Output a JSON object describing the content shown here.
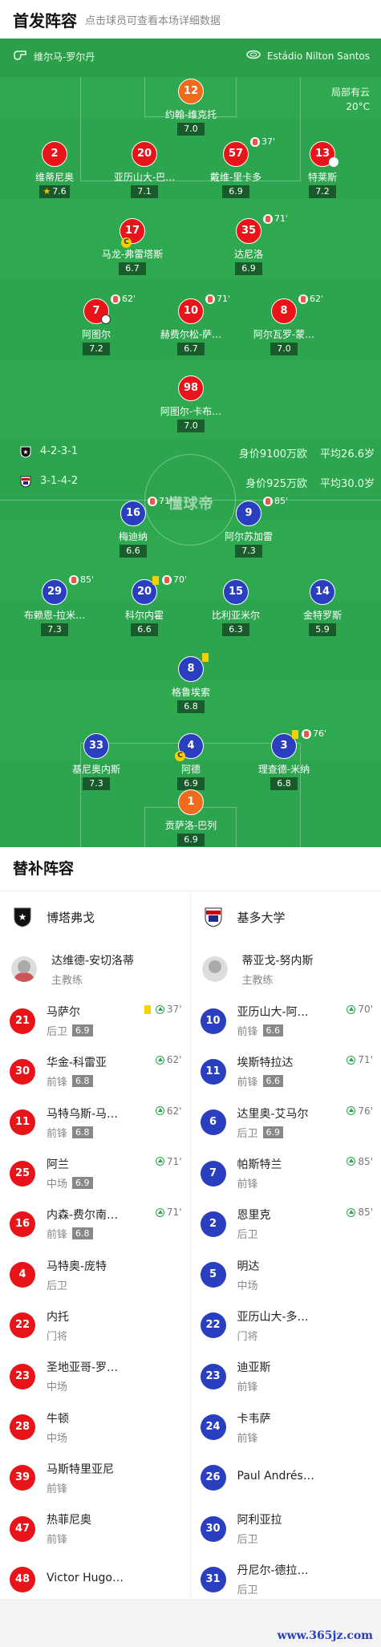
{
  "header": {
    "title": "首发阵容",
    "subtitle": "点击球员可查看本场详细数据"
  },
  "pitch": {
    "referee": "维尔马-罗尔丹",
    "stadium": "Estádio Nilton Santos",
    "weather": "局部有云",
    "temperature": "20°C",
    "center_logo": "懂球帝",
    "home_info": {
      "formation": "4-2-3-1",
      "value": "身价9100万欧",
      "age": "平均26.6岁"
    },
    "away_info": {
      "formation": "3-1-4-2",
      "value": "身价925万欧",
      "age": "平均30.0岁"
    },
    "home_players": [
      {
        "num": "12",
        "name": "约翰-维克托",
        "rating": "7.0",
        "color": "orange"
      },
      {
        "num": "2",
        "name": "维蒂尼奥",
        "rating": "7.6",
        "color": "red",
        "star": true
      },
      {
        "num": "20",
        "name": "亚历山大-巴…",
        "rating": "7.1",
        "color": "red"
      },
      {
        "num": "57",
        "name": "戴维-里卡多",
        "rating": "6.9",
        "color": "red",
        "sub": "37'"
      },
      {
        "num": "13",
        "name": "特莱斯",
        "rating": "7.2",
        "color": "red"
      },
      {
        "num": "17",
        "name": "马龙-弗雷塔斯",
        "rating": "6.7",
        "color": "red",
        "captain": "C"
      },
      {
        "num": "35",
        "name": "达尼洛",
        "rating": "6.9",
        "color": "red",
        "sub": "71'"
      },
      {
        "num": "7",
        "name": "阿图尔",
        "rating": "7.2",
        "color": "red",
        "sub": "62'"
      },
      {
        "num": "10",
        "name": "赫费尔松-萨…",
        "rating": "6.7",
        "color": "red",
        "sub": "71'"
      },
      {
        "num": "8",
        "name": "阿尔瓦罗-蒙…",
        "rating": "7.0",
        "color": "red",
        "sub": "62'"
      },
      {
        "num": "98",
        "name": "阿图尔-卡布…",
        "rating": "7.0",
        "color": "red"
      }
    ],
    "away_players": [
      {
        "num": "16",
        "name": "梅迪纳",
        "rating": "6.6",
        "color": "blue",
        "sub": "71'"
      },
      {
        "num": "9",
        "name": "阿尔苏加雷",
        "rating": "7.3",
        "color": "blue",
        "sub": "85'"
      },
      {
        "num": "29",
        "name": "布赖恩-拉米…",
        "rating": "7.3",
        "color": "blue",
        "sub": "85'"
      },
      {
        "num": "20",
        "name": "科尔内霍",
        "rating": "6.6",
        "color": "blue",
        "sub": "70'",
        "yellow": true
      },
      {
        "num": "15",
        "name": "比利亚米尔",
        "rating": "6.3",
        "color": "blue"
      },
      {
        "num": "14",
        "name": "金特罗斯",
        "rating": "5.9",
        "color": "blue"
      },
      {
        "num": "8",
        "name": "格鲁埃索",
        "rating": "6.8",
        "color": "blue",
        "yellow": true
      },
      {
        "num": "33",
        "name": "基尼奥内斯",
        "rating": "7.3",
        "color": "blue"
      },
      {
        "num": "4",
        "name": "阿德",
        "rating": "6.9",
        "color": "blue",
        "captain": "C"
      },
      {
        "num": "3",
        "name": "理查德-米纳",
        "rating": "6.8",
        "color": "blue",
        "sub": "76'",
        "yellow": true
      },
      {
        "num": "1",
        "name": "贡萨洛-巴列",
        "rating": "6.9",
        "color": "orange"
      }
    ]
  },
  "subs": {
    "title": "替补阵容",
    "home": {
      "team": "博塔弗戈",
      "coach_name": "达维德-安切洛蒂",
      "coach_role": "主教练",
      "players": [
        {
          "num": "21",
          "name": "马萨尔",
          "pos": "后卫",
          "rating": "6.9",
          "time": "37'",
          "yellow": true
        },
        {
          "num": "30",
          "name": "华金-科雷亚",
          "pos": "前锋",
          "rating": "6.8",
          "time": "62'"
        },
        {
          "num": "11",
          "name": "马特乌斯-马…",
          "pos": "前锋",
          "rating": "6.8",
          "time": "62'"
        },
        {
          "num": "25",
          "name": "阿兰",
          "pos": "中场",
          "rating": "6.9",
          "time": "71'"
        },
        {
          "num": "16",
          "name": "内森-费尔南…",
          "pos": "前锋",
          "rating": "6.8",
          "time": "71'"
        },
        {
          "num": "4",
          "name": "马特奥-庞特",
          "pos": "后卫"
        },
        {
          "num": "22",
          "name": "内托",
          "pos": "门将"
        },
        {
          "num": "23",
          "name": "圣地亚哥-罗…",
          "pos": "中场"
        },
        {
          "num": "28",
          "name": "牛顿",
          "pos": "中场"
        },
        {
          "num": "39",
          "name": "马斯特里亚尼",
          "pos": "前锋"
        },
        {
          "num": "47",
          "name": "热菲尼奥",
          "pos": "前锋"
        },
        {
          "num": "48",
          "name": "Victor Hugo …",
          "pos": ""
        }
      ]
    },
    "away": {
      "team": "基多大学",
      "coach_name": "蒂亚戈-努内斯",
      "coach_role": "主教练",
      "players": [
        {
          "num": "10",
          "name": "亚历山大-阿…",
          "pos": "前锋",
          "rating": "6.6",
          "time": "70'"
        },
        {
          "num": "11",
          "name": "埃斯特拉达",
          "pos": "前锋",
          "rating": "6.6",
          "time": "71'"
        },
        {
          "num": "6",
          "name": "达里奥-艾马尔",
          "pos": "后卫",
          "rating": "6.9",
          "time": "76'"
        },
        {
          "num": "7",
          "name": "帕斯特兰",
          "pos": "前锋",
          "time": "85'"
        },
        {
          "num": "2",
          "name": "恩里克",
          "pos": "后卫",
          "time": "85'"
        },
        {
          "num": "5",
          "name": "明达",
          "pos": "中场"
        },
        {
          "num": "22",
          "name": "亚历山大-多…",
          "pos": "门将"
        },
        {
          "num": "23",
          "name": "迪亚斯",
          "pos": "前锋"
        },
        {
          "num": "24",
          "name": "卡韦萨",
          "pos": "前锋"
        },
        {
          "num": "26",
          "name": "Paul Andrés …",
          "pos": ""
        },
        {
          "num": "30",
          "name": "阿利亚拉",
          "pos": "后卫"
        },
        {
          "num": "31",
          "name": "丹尼尔-德拉…",
          "pos": "后卫"
        }
      ]
    }
  },
  "footer": {
    "watermark": "www.365jz.com"
  }
}
